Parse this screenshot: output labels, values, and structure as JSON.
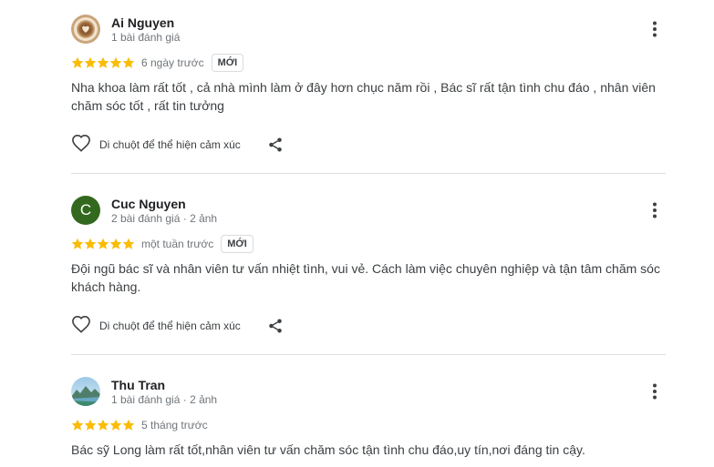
{
  "reviews": [
    {
      "name": "Ai Nguyen",
      "meta": "1 bài đánh giá",
      "rating": 5,
      "time": "6 ngày trước",
      "badge": "MỚI",
      "text": "Nha khoa làm rất tốt , cả nhà mình làm ở đây hơn chục năm rồi , Bác sĩ rất tận tình chu đáo , nhân viên chăm sóc tốt , rất tin tưởng",
      "like_label": "Di chuột để thể hiện cảm xúc"
    },
    {
      "name": "Cuc Nguyen",
      "meta": "2 bài đánh giá · 2 ảnh",
      "avatar_letter": "C",
      "rating": 5,
      "time": "một tuần trước",
      "badge": "MỚI",
      "text": "Đội ngũ bác sĩ và nhân viên tư vấn nhiệt tình, vui vẻ. Cách làm việc chuyên nghiệp và tận tâm chăm sóc khách hàng.",
      "like_label": "Di chuột để thể hiện cảm xúc"
    },
    {
      "name": "Thu Tran",
      "meta": "1 bài đánh giá · 2 ảnh",
      "rating": 5,
      "time": "5 tháng trước",
      "text": "Bác sỹ Long làm rất tốt,nhân viên tư vấn chăm sóc tận tình chu đáo,uy tín,nơi đáng tin cậy."
    }
  ],
  "icons": {
    "more": "more-vert-icon",
    "like": "heart-outline-icon",
    "share": "share-icon",
    "star": "star-icon"
  },
  "colors": {
    "star": "#fbbc04",
    "avatar_letter_bg": "#33691e",
    "secondary_text": "#70757a",
    "divider": "#e0e0e0"
  }
}
